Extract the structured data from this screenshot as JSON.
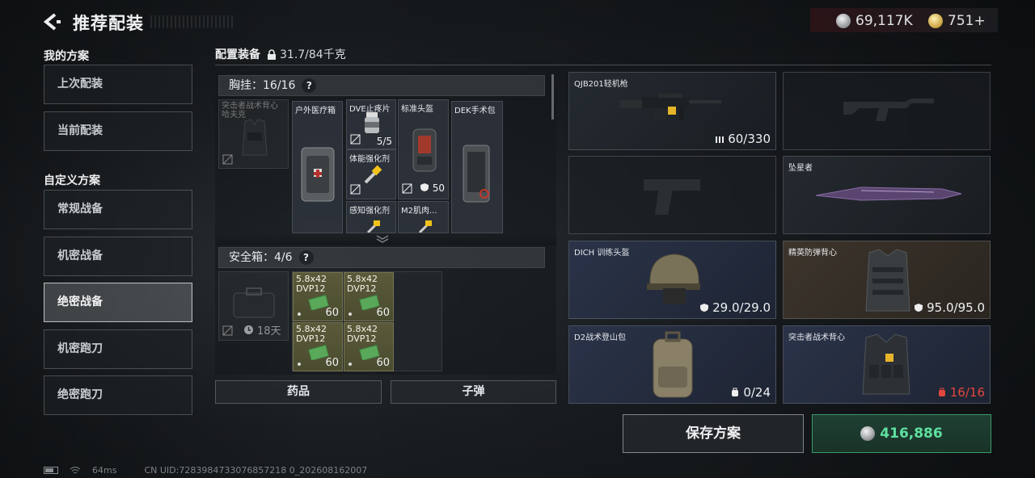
{
  "header": {
    "title": "推荐配装",
    "silver_amount": "69,117K",
    "gold_amount": "751+"
  },
  "left_menu": {
    "my_plans_label": "我的方案",
    "my_plans": [
      {
        "label": "上次配装"
      },
      {
        "label": "当前配装"
      }
    ],
    "custom_label": "自定义方案",
    "custom": [
      {
        "label": "常规战备",
        "active": false
      },
      {
        "label": "机密战备",
        "active": false
      },
      {
        "label": "绝密战备",
        "active": true
      },
      {
        "label": "机密跑刀",
        "active": false
      },
      {
        "label": "绝密跑刀",
        "active": false
      }
    ]
  },
  "loadout": {
    "label": "配置装备",
    "weight": "31.7/84千克"
  },
  "chest_rig": {
    "label": "胸挂：16/16",
    "help": "?",
    "items": [
      {
        "name": "突击者战术背心",
        "sub": "哈夫克",
        "count": ""
      },
      {
        "name": "户外医疗箱",
        "count": ""
      },
      {
        "name": "DVE止疼片",
        "count": "5/5"
      },
      {
        "name": "体能强化剂",
        "count": ""
      },
      {
        "name": "标准头盔",
        "count": "50"
      },
      {
        "name": "DEK手术包",
        "count": ""
      },
      {
        "name": "感知强化剂",
        "count": ""
      },
      {
        "name": "M2肌肉...",
        "count": ""
      }
    ]
  },
  "safe_box": {
    "label": "安全箱：4/6",
    "help": "?",
    "timer": "18天",
    "ammo": [
      {
        "name": "5.8x42 DVP12",
        "count": "60"
      },
      {
        "name": "5.8x42 DVP12",
        "count": "60"
      },
      {
        "name": "5.8x42 DVP12",
        "count": "60"
      },
      {
        "name": "5.8x42 DVP12",
        "count": "60"
      }
    ]
  },
  "bottom_tabs": {
    "medicine": "药品",
    "bullets": "子弹"
  },
  "equipment": [
    {
      "name": "QJB201轻机枪",
      "stat": "60/330",
      "icon": "ammo-icon",
      "style": "dark"
    },
    {
      "name": "",
      "stat": "",
      "icon": "",
      "style": "empty"
    },
    {
      "name": "",
      "stat": "",
      "icon": "",
      "style": "empty"
    },
    {
      "name": "坠星者",
      "stat": "",
      "icon": "",
      "style": "dark"
    },
    {
      "name": "DICH 训练头盔",
      "stat": "29.0/29.0",
      "icon": "shield-icon",
      "style": "blue"
    },
    {
      "name": "精英防弹背心",
      "stat": "95.0/95.0",
      "icon": "shield-icon",
      "style": "brown"
    },
    {
      "name": "D2战术登山包",
      "stat": "0/24",
      "icon": "backpack-icon",
      "style": "blue"
    },
    {
      "name": "突击者战术背心",
      "stat": "16/16",
      "icon": "vest-icon",
      "style": "blue",
      "stat_color": "red"
    }
  ],
  "actions": {
    "save_label": "保存方案",
    "buy_amount": "416,886"
  },
  "footer": {
    "ping": "64ms",
    "uid": "CN UID:7283984733076857218 0_202608162007"
  },
  "colors": {
    "accent_green": "#5fe0a0",
    "alert_red": "#e2473c",
    "tag_yellow": "#f2c21a"
  }
}
